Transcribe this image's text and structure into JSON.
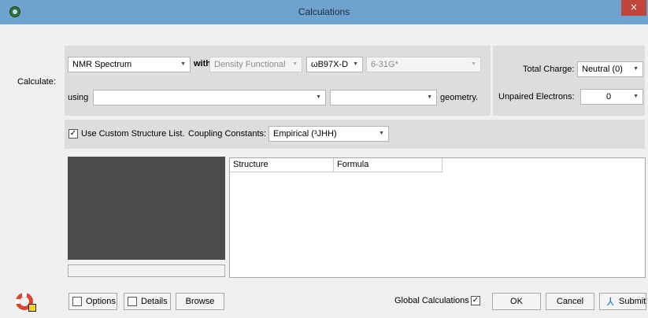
{
  "window": {
    "title": "Calculations",
    "close_icon": "×"
  },
  "calculate": {
    "label": "Calculate:",
    "type": "NMR Spectrum",
    "with_label": "with",
    "theory": "Density Functional",
    "functional": "ωB97X-D",
    "basis": "6-31G*",
    "using_label": "using",
    "using_value": "",
    "using_value2": "",
    "geometry_label": "geometry."
  },
  "charge": {
    "total_charge_label": "Total Charge:",
    "total_charge": "Neutral (0)",
    "unpaired_label": "Unpaired Electrons:",
    "unpaired": "0"
  },
  "structure_options": {
    "custom_list_label": "Use Custom Structure List.",
    "custom_list_checked": true,
    "coupling_label": "Coupling Constants:",
    "coupling_value": "Empirical (³JHH)"
  },
  "table": {
    "columns": [
      "Structure",
      "Formula"
    ],
    "rows": []
  },
  "buttons": {
    "options": "Options",
    "details": "Details",
    "browse": "Browse",
    "global_calculations": "Global Calculations",
    "ok": "OK",
    "cancel": "Cancel",
    "submit": "Submit"
  },
  "checkmark": "✓",
  "arrow_glyph": "▼",
  "icons": [
    "app-icon",
    "close-icon",
    "help-lifebuoy-icon",
    "submit-icon"
  ]
}
